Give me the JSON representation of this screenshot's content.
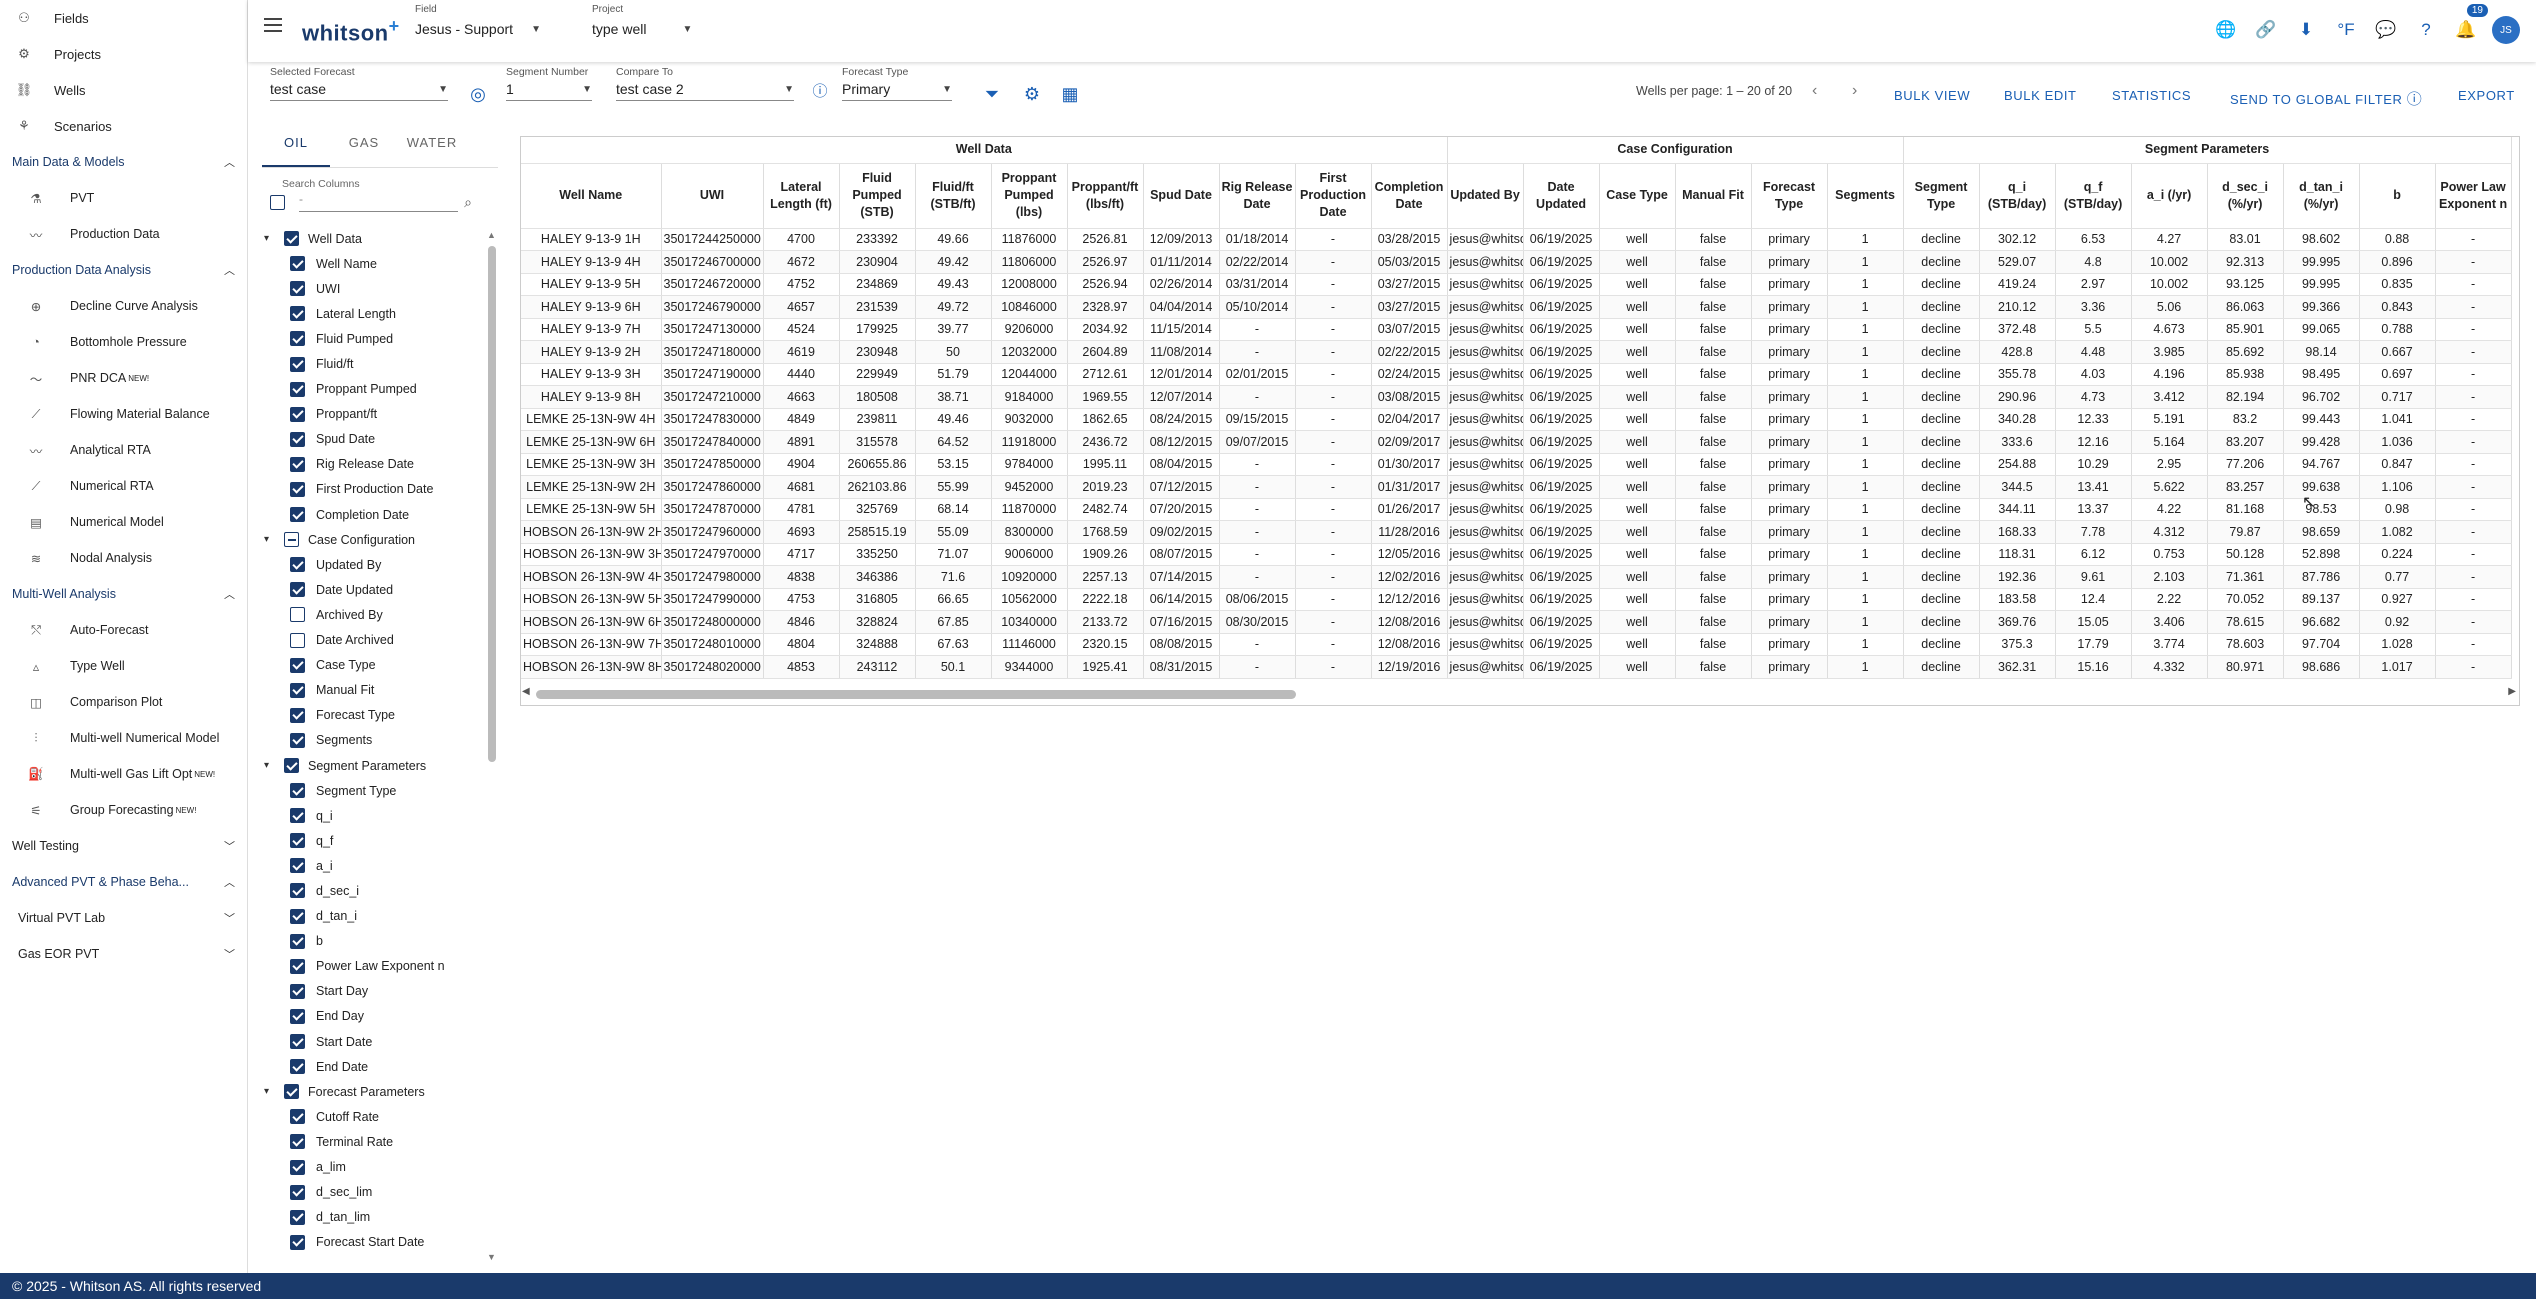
{
  "app": {
    "logo": "whitson",
    "logo_plus": "+",
    "footer": "© 2025 - Whitson AS. All rights reserved"
  },
  "sidebar": {
    "top_items": [
      {
        "label": "Fields",
        "icon": "fields-icon"
      },
      {
        "label": "Projects",
        "icon": "projects-icon"
      },
      {
        "label": "Wells",
        "icon": "wells-icon"
      },
      {
        "label": "Scenarios",
        "icon": "scenarios-icon"
      }
    ],
    "sections": [
      {
        "title": "Main Data & Models",
        "expanded": true,
        "items": [
          {
            "label": "PVT",
            "new": ""
          },
          {
            "label": "Production Data",
            "new": ""
          }
        ]
      },
      {
        "title": "Production Data Analysis",
        "expanded": true,
        "items": [
          {
            "label": "Decline Curve Analysis",
            "new": ""
          },
          {
            "label": "Bottomhole Pressure",
            "new": ""
          },
          {
            "label": "PNR DCA",
            "new": "NEW!"
          },
          {
            "label": "Flowing Material Balance",
            "new": ""
          },
          {
            "label": "Analytical RTA",
            "new": ""
          },
          {
            "label": "Numerical RTA",
            "new": ""
          },
          {
            "label": "Numerical Model",
            "new": ""
          },
          {
            "label": "Nodal Analysis",
            "new": ""
          }
        ]
      },
      {
        "title": "Multi-Well Analysis",
        "expanded": true,
        "items": [
          {
            "label": "Auto-Forecast",
            "new": ""
          },
          {
            "label": "Type Well",
            "new": ""
          },
          {
            "label": "Comparison Plot",
            "new": ""
          },
          {
            "label": "Multi-well Numerical Model",
            "new": ""
          },
          {
            "label": "Multi-well Gas Lift Opt",
            "new": "NEW!"
          },
          {
            "label": "Group Forecasting",
            "new": "NEW!"
          }
        ]
      }
    ],
    "well_testing": "Well Testing",
    "advanced": "Advanced PVT & Phase Beha...",
    "virtual_pvt": "Virtual PVT Lab",
    "gas_eor": "Gas EOR PVT"
  },
  "topbar": {
    "field_label": "Field",
    "field_value": "Jesus - Support",
    "project_label": "Project",
    "project_value": "type well",
    "notif_count": "19",
    "avatar": "JS",
    "unit": "°F"
  },
  "controls": {
    "selected_forecast_label": "Selected Forecast",
    "selected_forecast": "test case",
    "segment_label": "Segment Number",
    "segment": "1",
    "compare_label": "Compare To",
    "compare": "test case 2",
    "forecast_type_label": "Forecast Type",
    "forecast_type": "Primary",
    "pager": "Wells per page: 1 – 20 of 20",
    "bulk_view": "BULK VIEW",
    "bulk_edit": "BULK EDIT",
    "statistics": "STATISTICS",
    "global_filter": "SEND TO GLOBAL FILTER",
    "export": "EXPORT"
  },
  "columns_panel": {
    "tabs": [
      "OIL",
      "GAS",
      "WATER"
    ],
    "search_label": "Search Columns",
    "search_placeholder": "-",
    "groups": [
      {
        "label": "Well Data",
        "state": "on",
        "items": [
          {
            "label": "Well Name",
            "checked": true
          },
          {
            "label": "UWI",
            "checked": true
          },
          {
            "label": "Lateral Length",
            "checked": true
          },
          {
            "label": "Fluid Pumped",
            "checked": true
          },
          {
            "label": "Fluid/ft",
            "checked": true
          },
          {
            "label": "Proppant Pumped",
            "checked": true
          },
          {
            "label": "Proppant/ft",
            "checked": true
          },
          {
            "label": "Spud Date",
            "checked": true
          },
          {
            "label": "Rig Release Date",
            "checked": true
          },
          {
            "label": "First Production Date",
            "checked": true
          },
          {
            "label": "Completion Date",
            "checked": true
          }
        ]
      },
      {
        "label": "Case Configuration",
        "state": "ind",
        "items": [
          {
            "label": "Updated By",
            "checked": true
          },
          {
            "label": "Date Updated",
            "checked": true
          },
          {
            "label": "Archived By",
            "checked": false
          },
          {
            "label": "Date Archived",
            "checked": false
          },
          {
            "label": "Case Type",
            "checked": true
          },
          {
            "label": "Manual Fit",
            "checked": true
          },
          {
            "label": "Forecast Type",
            "checked": true
          },
          {
            "label": "Segments",
            "checked": true
          }
        ]
      },
      {
        "label": "Segment Parameters",
        "state": "on",
        "items": [
          {
            "label": "Segment Type",
            "checked": true
          },
          {
            "label": "q_i",
            "checked": true
          },
          {
            "label": "q_f",
            "checked": true
          },
          {
            "label": "a_i",
            "checked": true
          },
          {
            "label": "d_sec_i",
            "checked": true
          },
          {
            "label": "d_tan_i",
            "checked": true
          },
          {
            "label": "b",
            "checked": true
          },
          {
            "label": "Power Law Exponent n",
            "checked": true
          },
          {
            "label": "Start Day",
            "checked": true
          },
          {
            "label": "End Day",
            "checked": true
          },
          {
            "label": "Start Date",
            "checked": true
          },
          {
            "label": "End Date",
            "checked": true
          }
        ]
      },
      {
        "label": "Forecast Parameters",
        "state": "on",
        "items": [
          {
            "label": "Cutoff Rate",
            "checked": true
          },
          {
            "label": "Terminal Rate",
            "checked": true
          },
          {
            "label": "a_lim",
            "checked": true
          },
          {
            "label": "d_sec_lim",
            "checked": true
          },
          {
            "label": "d_tan_lim",
            "checked": true
          },
          {
            "label": "Forecast Start Date",
            "checked": true
          }
        ]
      }
    ]
  },
  "table": {
    "groups": [
      {
        "label": "Well Data",
        "span": 11
      },
      {
        "label": "Case Configuration",
        "span": 6
      },
      {
        "label": "Segment Parameters",
        "span": 8
      }
    ],
    "headers": [
      "Well Name",
      "UWI",
      "Lateral Length (ft)",
      "Fluid Pumped (STB)",
      "Fluid/ft (STB/ft)",
      "Proppant Pumped (lbs)",
      "Proppant/ft (lbs/ft)",
      "Spud Date",
      "Rig Release Date",
      "First Production Date",
      "Completion Date",
      "Updated By",
      "Date Updated",
      "Case Type",
      "Manual Fit",
      "Forecast Type",
      "Segments",
      "Segment Type",
      "q_i (STB/day)",
      "q_f (STB/day)",
      "a_i (/yr)",
      "d_sec_i (%/yr)",
      "d_tan_i (%/yr)",
      "b",
      "Power Law Exponent n"
    ],
    "rows": [
      [
        "HALEY 9-13-9 1H",
        "35017244250000",
        "4700",
        "233392",
        "49.66",
        "11876000",
        "2526.81",
        "12/09/2013",
        "01/18/2014",
        "-",
        "03/28/2015",
        "jesus@whitson",
        "06/19/2025",
        "well",
        "false",
        "primary",
        "1",
        "decline",
        "302.12",
        "6.53",
        "4.27",
        "83.01",
        "98.602",
        "0.88",
        "-"
      ],
      [
        "HALEY 9-13-9 4H",
        "35017246700000",
        "4672",
        "230904",
        "49.42",
        "11806000",
        "2526.97",
        "01/11/2014",
        "02/22/2014",
        "-",
        "05/03/2015",
        "jesus@whitson",
        "06/19/2025",
        "well",
        "false",
        "primary",
        "1",
        "decline",
        "529.07",
        "4.8",
        "10.002",
        "92.313",
        "99.995",
        "0.896",
        "-"
      ],
      [
        "HALEY 9-13-9 5H",
        "35017246720000",
        "4752",
        "234869",
        "49.43",
        "12008000",
        "2526.94",
        "02/26/2014",
        "03/31/2014",
        "-",
        "03/27/2015",
        "jesus@whitson",
        "06/19/2025",
        "well",
        "false",
        "primary",
        "1",
        "decline",
        "419.24",
        "2.97",
        "10.002",
        "93.125",
        "99.995",
        "0.835",
        "-"
      ],
      [
        "HALEY 9-13-9 6H",
        "35017246790000",
        "4657",
        "231539",
        "49.72",
        "10846000",
        "2328.97",
        "04/04/2014",
        "05/10/2014",
        "-",
        "03/27/2015",
        "jesus@whitson",
        "06/19/2025",
        "well",
        "false",
        "primary",
        "1",
        "decline",
        "210.12",
        "3.36",
        "5.06",
        "86.063",
        "99.366",
        "0.843",
        "-"
      ],
      [
        "HALEY 9-13-9 7H",
        "35017247130000",
        "4524",
        "179925",
        "39.77",
        "9206000",
        "2034.92",
        "11/15/2014",
        "-",
        "-",
        "03/07/2015",
        "jesus@whitson",
        "06/19/2025",
        "well",
        "false",
        "primary",
        "1",
        "decline",
        "372.48",
        "5.5",
        "4.673",
        "85.901",
        "99.065",
        "0.788",
        "-"
      ],
      [
        "HALEY 9-13-9 2H",
        "35017247180000",
        "4619",
        "230948",
        "50",
        "12032000",
        "2604.89",
        "11/08/2014",
        "-",
        "-",
        "02/22/2015",
        "jesus@whitson",
        "06/19/2025",
        "well",
        "false",
        "primary",
        "1",
        "decline",
        "428.8",
        "4.48",
        "3.985",
        "85.692",
        "98.14",
        "0.667",
        "-"
      ],
      [
        "HALEY 9-13-9 3H",
        "35017247190000",
        "4440",
        "229949",
        "51.79",
        "12044000",
        "2712.61",
        "12/01/2014",
        "02/01/2015",
        "-",
        "02/24/2015",
        "jesus@whitson",
        "06/19/2025",
        "well",
        "false",
        "primary",
        "1",
        "decline",
        "355.78",
        "4.03",
        "4.196",
        "85.938",
        "98.495",
        "0.697",
        "-"
      ],
      [
        "HALEY 9-13-9 8H",
        "35017247210000",
        "4663",
        "180508",
        "38.71",
        "9184000",
        "1969.55",
        "12/07/2014",
        "-",
        "-",
        "03/08/2015",
        "jesus@whitson",
        "06/19/2025",
        "well",
        "false",
        "primary",
        "1",
        "decline",
        "290.96",
        "4.73",
        "3.412",
        "82.194",
        "96.702",
        "0.717",
        "-"
      ],
      [
        "LEMKE 25-13N-9W 4H",
        "35017247830000",
        "4849",
        "239811",
        "49.46",
        "9032000",
        "1862.65",
        "08/24/2015",
        "09/15/2015",
        "-",
        "02/04/2017",
        "jesus@whitson",
        "06/19/2025",
        "well",
        "false",
        "primary",
        "1",
        "decline",
        "340.28",
        "12.33",
        "5.191",
        "83.2",
        "99.443",
        "1.041",
        "-"
      ],
      [
        "LEMKE 25-13N-9W 6H",
        "35017247840000",
        "4891",
        "315578",
        "64.52",
        "11918000",
        "2436.72",
        "08/12/2015",
        "09/07/2015",
        "-",
        "02/09/2017",
        "jesus@whitson",
        "06/19/2025",
        "well",
        "false",
        "primary",
        "1",
        "decline",
        "333.6",
        "12.16",
        "5.164",
        "83.207",
        "99.428",
        "1.036",
        "-"
      ],
      [
        "LEMKE 25-13N-9W 3H",
        "35017247850000",
        "4904",
        "260655.86",
        "53.15",
        "9784000",
        "1995.11",
        "08/04/2015",
        "-",
        "-",
        "01/30/2017",
        "jesus@whitson",
        "06/19/2025",
        "well",
        "false",
        "primary",
        "1",
        "decline",
        "254.88",
        "10.29",
        "2.95",
        "77.206",
        "94.767",
        "0.847",
        "-"
      ],
      [
        "LEMKE 25-13N-9W 2H",
        "35017247860000",
        "4681",
        "262103.86",
        "55.99",
        "9452000",
        "2019.23",
        "07/12/2015",
        "-",
        "-",
        "01/31/2017",
        "jesus@whitson",
        "06/19/2025",
        "well",
        "false",
        "primary",
        "1",
        "decline",
        "344.5",
        "13.41",
        "5.622",
        "83.257",
        "99.638",
        "1.106",
        "-"
      ],
      [
        "LEMKE 25-13N-9W 5H",
        "35017247870000",
        "4781",
        "325769",
        "68.14",
        "11870000",
        "2482.74",
        "07/20/2015",
        "-",
        "-",
        "01/26/2017",
        "jesus@whitson",
        "06/19/2025",
        "well",
        "false",
        "primary",
        "1",
        "decline",
        "344.11",
        "13.37",
        "4.22",
        "81.168",
        "98.53",
        "0.98",
        "-"
      ],
      [
        "HOBSON 26-13N-9W 2H",
        "35017247960000",
        "4693",
        "258515.19",
        "55.09",
        "8300000",
        "1768.59",
        "09/02/2015",
        "-",
        "-",
        "11/28/2016",
        "jesus@whitson",
        "06/19/2025",
        "well",
        "false",
        "primary",
        "1",
        "decline",
        "168.33",
        "7.78",
        "4.312",
        "79.87",
        "98.659",
        "1.082",
        "-"
      ],
      [
        "HOBSON 26-13N-9W 3H",
        "35017247970000",
        "4717",
        "335250",
        "71.07",
        "9006000",
        "1909.26",
        "08/07/2015",
        "-",
        "-",
        "12/05/2016",
        "jesus@whitson",
        "06/19/2025",
        "well",
        "false",
        "primary",
        "1",
        "decline",
        "118.31",
        "6.12",
        "0.753",
        "50.128",
        "52.898",
        "0.224",
        "-"
      ],
      [
        "HOBSON 26-13N-9W 4H",
        "35017247980000",
        "4838",
        "346386",
        "71.6",
        "10920000",
        "2257.13",
        "07/14/2015",
        "-",
        "-",
        "12/02/2016",
        "jesus@whitson",
        "06/19/2025",
        "well",
        "false",
        "primary",
        "1",
        "decline",
        "192.36",
        "9.61",
        "2.103",
        "71.361",
        "87.786",
        "0.77",
        "-"
      ],
      [
        "HOBSON 26-13N-9W 5H",
        "35017247990000",
        "4753",
        "316805",
        "66.65",
        "10562000",
        "2222.18",
        "06/14/2015",
        "08/06/2015",
        "-",
        "12/12/2016",
        "jesus@whitson",
        "06/19/2025",
        "well",
        "false",
        "primary",
        "1",
        "decline",
        "183.58",
        "12.4",
        "2.22",
        "70.052",
        "89.137",
        "0.927",
        "-"
      ],
      [
        "HOBSON 26-13N-9W 6H",
        "35017248000000",
        "4846",
        "328824",
        "67.85",
        "10340000",
        "2133.72",
        "07/16/2015",
        "08/30/2015",
        "-",
        "12/08/2016",
        "jesus@whitson",
        "06/19/2025",
        "well",
        "false",
        "primary",
        "1",
        "decline",
        "369.76",
        "15.05",
        "3.406",
        "78.615",
        "96.682",
        "0.92",
        "-"
      ],
      [
        "HOBSON 26-13N-9W 7H",
        "35017248010000",
        "4804",
        "324888",
        "67.63",
        "11146000",
        "2320.15",
        "08/08/2015",
        "-",
        "-",
        "12/08/2016",
        "jesus@whitson",
        "06/19/2025",
        "well",
        "false",
        "primary",
        "1",
        "decline",
        "375.3",
        "17.79",
        "3.774",
        "78.603",
        "97.704",
        "1.028",
        "-"
      ],
      [
        "HOBSON 26-13N-9W 8H",
        "35017248020000",
        "4853",
        "243112",
        "50.1",
        "9344000",
        "1925.41",
        "08/31/2015",
        "-",
        "-",
        "12/19/2016",
        "jesus@whitson",
        "06/19/2025",
        "well",
        "false",
        "primary",
        "1",
        "decline",
        "362.31",
        "15.16",
        "4.332",
        "80.971",
        "98.686",
        "1.017",
        "-"
      ]
    ]
  }
}
